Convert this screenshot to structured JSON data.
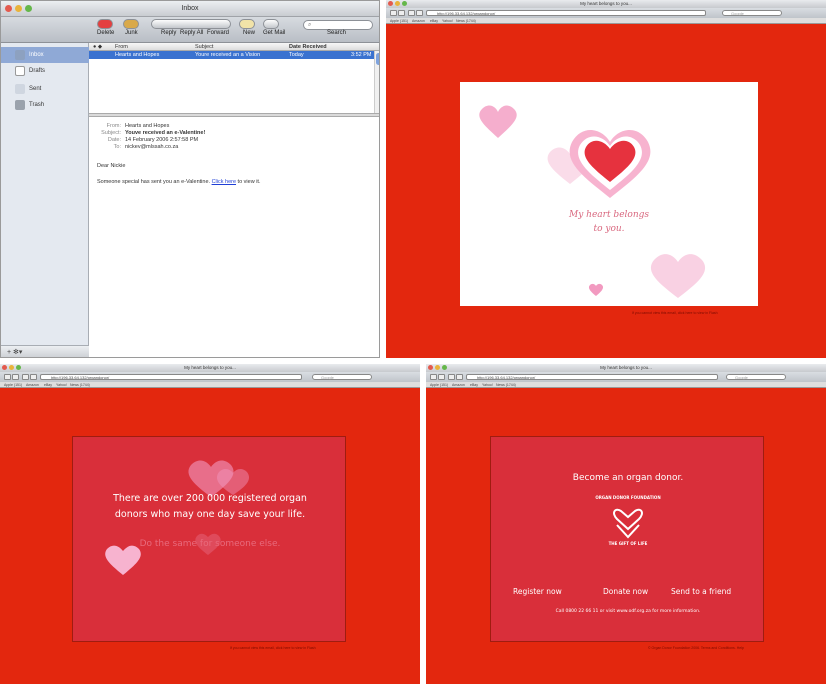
{
  "mail": {
    "title": "Inbox",
    "toolbar": [
      "Delete",
      "Junk",
      "Reply",
      "Reply All",
      "Forward",
      "New",
      "Get Mail"
    ],
    "search_label": "Search",
    "mailboxes": [
      {
        "label": "Inbox",
        "selected": true
      },
      {
        "label": "Drafts",
        "selected": false
      },
      {
        "label": "Sent",
        "selected": false
      },
      {
        "label": "Trash",
        "selected": false
      }
    ],
    "columns": {
      "from": "From",
      "subject": "Subject",
      "date": "Date Received"
    },
    "row": {
      "from": "Hearts and Hopes",
      "subject": "Youre received an a Vision",
      "date": "Today",
      "time": "3:52 PM"
    },
    "message": {
      "from_k": "From:",
      "from_v": "Hearts and Hopes",
      "subject_k": "Subject:",
      "subject_v": "Youve received an e-Valentine!",
      "date_k": "Date:",
      "date_v": "14 February 2006 2:57:58 PM",
      "to_k": "To:",
      "to_v": "nickev@mlssah.co.za",
      "greeting": "Dear Nickie",
      "body_pre": "Someone special has sent you an e-Valentine.",
      "body_link": "Click here",
      "body_post": "to view it."
    },
    "footer_icons": "+  ✻▾"
  },
  "browser": {
    "title": "My heart belongs to you...",
    "url": "http://196.33.64.132/organdonor/",
    "search": "Google",
    "bookmarks": [
      "Apple (151)",
      "Amazon",
      "eBay",
      "Yahoo!",
      "News (1744)"
    ]
  },
  "card1": {
    "text_line1": "My heart belongs",
    "text_line2": "to you.",
    "footer": "If you cannot view this email, click here to view in Flash"
  },
  "card2": {
    "line1": "There are over 200 000 registered organ",
    "line2": "donors who may one day save your life.",
    "line3": "Do the same for someone else.",
    "footer": "If you cannot view this email, click here to view in Flash"
  },
  "card3": {
    "title": "Become an organ donor.",
    "logo_top": "ORGAN DONOR FOUNDATION",
    "logo_bottom": "THE GIFT OF LIFE",
    "links": [
      "Register now",
      "Donate now",
      "Send to a friend"
    ],
    "contact": "Call 0800 22 66 11 or visit www.odf.org.za for more information.",
    "footer": "© Organ Donor Foundation 2006. Terms and Conditions. Help"
  },
  "colors": {
    "red": "#e3270e",
    "card": "#d92f3a",
    "heart": "#e6323e",
    "heart_pink": "#f29ac0"
  }
}
